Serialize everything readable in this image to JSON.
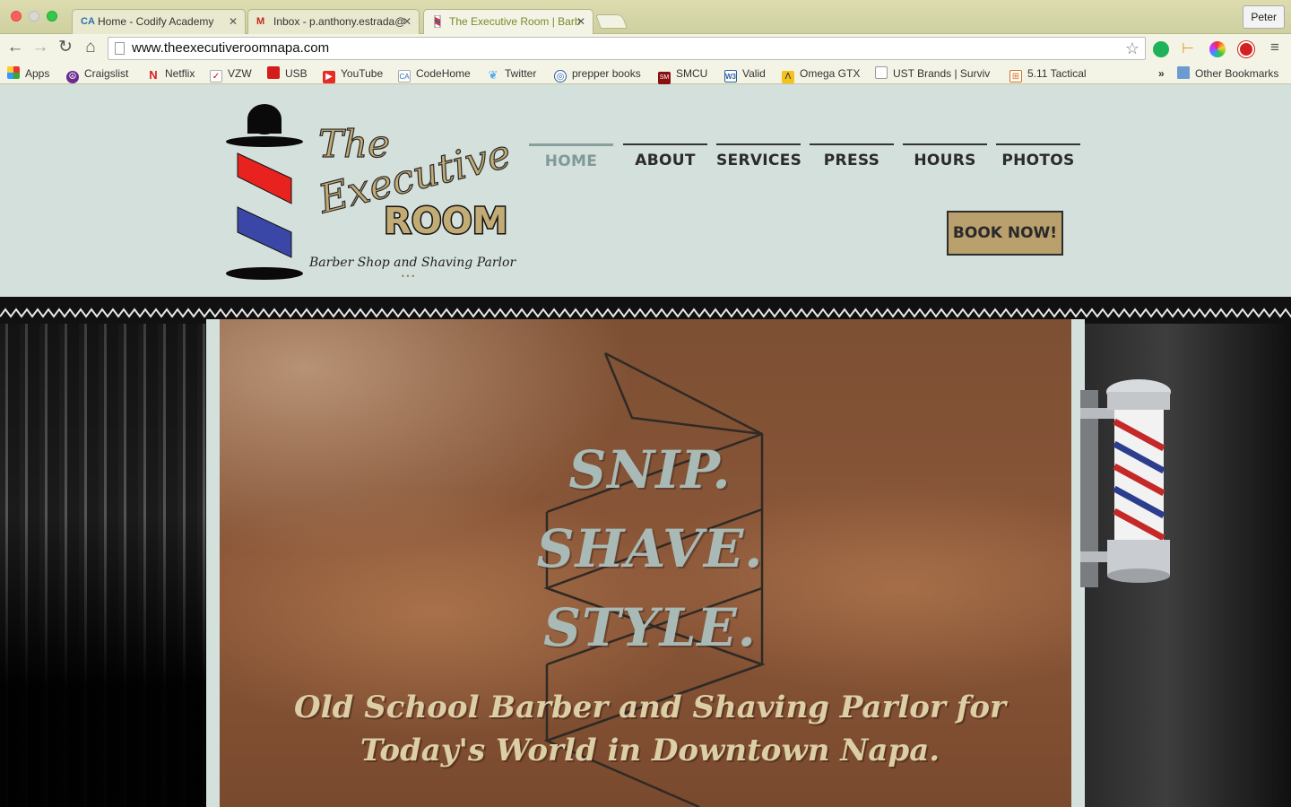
{
  "browser": {
    "tabs": [
      {
        "label": "Home - Codify Academy",
        "icon": "CA"
      },
      {
        "label": "Inbox - p.anthony.estrada@",
        "icon": "M"
      },
      {
        "label": "The Executive Room | Barb",
        "icon": "barber-pole"
      }
    ],
    "profile_name": "Peter",
    "url": "www.theexecutiveroomnapa.com",
    "bookmarks": [
      {
        "label": "Apps",
        "icon": "apps-grid-icon"
      },
      {
        "label": "Craigslist",
        "icon": "peace-icon"
      },
      {
        "label": "Netflix",
        "icon": "netflix-icon"
      },
      {
        "label": "VZW",
        "icon": "vzw-icon"
      },
      {
        "label": "USB",
        "icon": "usb-icon"
      },
      {
        "label": "YouTube",
        "icon": "youtube-icon"
      },
      {
        "label": "CodeHome",
        "icon": "codify-icon"
      },
      {
        "label": "Twitter",
        "icon": "twitter-icon"
      },
      {
        "label": "prepper books",
        "icon": "globe-icon"
      },
      {
        "label": "SMCU",
        "icon": "smcu-icon"
      },
      {
        "label": "Valid",
        "icon": "w3c-icon"
      },
      {
        "label": "Omega GTX",
        "icon": "omega-icon"
      },
      {
        "label": "UST Brands | Surviv",
        "icon": "page-icon"
      },
      {
        "label": "5.11 Tactical",
        "icon": "tactical-icon"
      }
    ],
    "other_bookmarks": "Other Bookmarks",
    "overflow": "»"
  },
  "site": {
    "logo": {
      "line1": "The",
      "line2": "Executive",
      "line3": "ROOM",
      "subtitle": "Barber Shop and Shaving Parlor"
    },
    "nav": [
      "HOME",
      "ABOUT",
      "SERVICES",
      "PRESS",
      "HOURS",
      "PHOTOS"
    ],
    "active_nav": "HOME",
    "book_button": "BOOK NOW!",
    "hero": {
      "line1": "SNIP.",
      "line2": "SHAVE.",
      "line3": "STYLE.",
      "tagline": "Old School Barber and Shaving Parlor for Today's World in Downtown Napa."
    }
  },
  "colors": {
    "header_bg": "#d4e0dc",
    "nav_active": "#7f9a98",
    "book_button_bg": "#b9a06d",
    "hero_text": "#a9bab6",
    "tagline_text": "#dccfa6"
  }
}
